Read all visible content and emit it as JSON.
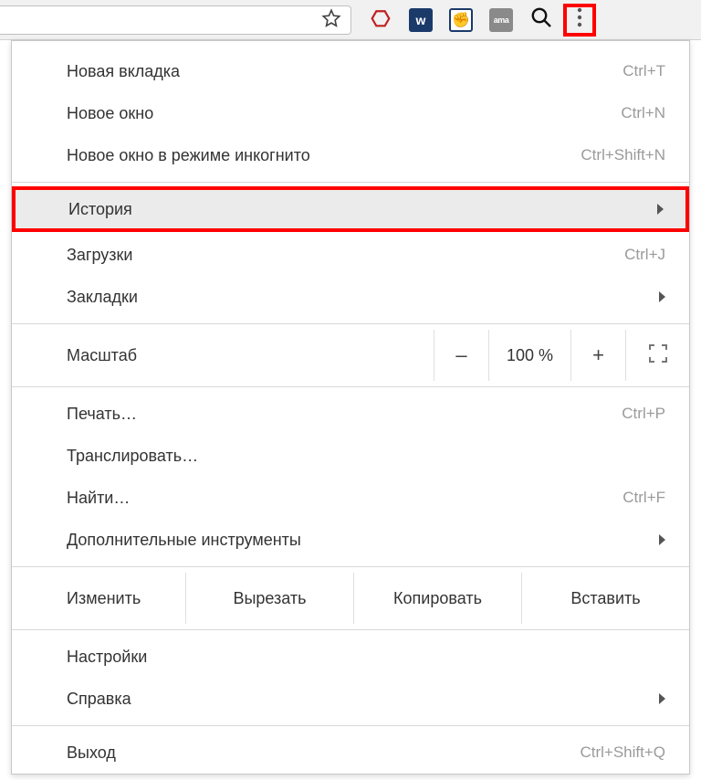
{
  "menu": {
    "new_tab": {
      "label": "Новая вкладка",
      "shortcut": "Ctrl+T"
    },
    "new_window": {
      "label": "Новое окно",
      "shortcut": "Ctrl+N"
    },
    "incognito": {
      "label": "Новое окно в режиме инкогнито",
      "shortcut": "Ctrl+Shift+N"
    },
    "history": {
      "label": "История"
    },
    "downloads": {
      "label": "Загрузки",
      "shortcut": "Ctrl+J"
    },
    "bookmarks": {
      "label": "Закладки"
    },
    "zoom": {
      "label": "Масштаб",
      "value": "100 %",
      "minus": "–",
      "plus": "+"
    },
    "print": {
      "label": "Печать…",
      "shortcut": "Ctrl+P"
    },
    "cast": {
      "label": "Транслировать…"
    },
    "find": {
      "label": "Найти…",
      "shortcut": "Ctrl+F"
    },
    "more_tools": {
      "label": "Дополнительные инструменты"
    },
    "edit": {
      "label": "Изменить",
      "cut": "Вырезать",
      "copy": "Копировать",
      "paste": "Вставить"
    },
    "settings": {
      "label": "Настройки"
    },
    "help": {
      "label": "Справка"
    },
    "exit": {
      "label": "Выход",
      "shortcut": "Ctrl+Shift+Q"
    }
  },
  "ext": {
    "vk": "w",
    "fist": "✊",
    "ama": "ama"
  }
}
